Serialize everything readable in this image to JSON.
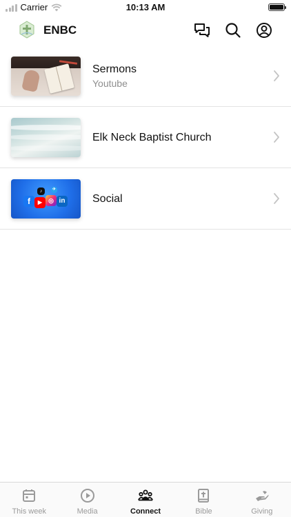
{
  "status_bar": {
    "carrier": "Carrier",
    "time": "10:13 AM"
  },
  "header": {
    "title": "ENBC",
    "icons": [
      "chat-icon",
      "search-icon",
      "account-icon"
    ]
  },
  "list": {
    "items": [
      {
        "title": "Sermons",
        "subtitle": "Youtube",
        "thumbnail": "sermons-bible-image"
      },
      {
        "title": "Elk Neck Baptist Church",
        "thumbnail": "ocean-waves-image"
      },
      {
        "title": "Social",
        "thumbnail": "social-media-icons-image"
      }
    ]
  },
  "tabs": [
    {
      "label": "This week",
      "icon": "calendar-icon",
      "active": false
    },
    {
      "label": "Media",
      "icon": "play-icon",
      "active": false
    },
    {
      "label": "Connect",
      "icon": "people-icon",
      "active": true
    },
    {
      "label": "Bible",
      "icon": "bible-icon",
      "active": false
    },
    {
      "label": "Giving",
      "icon": "giving-hand-icon",
      "active": false
    }
  ],
  "colors": {
    "active_tab": "#111111",
    "inactive_tab": "#9a9a9a",
    "subtitle": "#8e8e8e",
    "divider": "#e3e3e3"
  }
}
